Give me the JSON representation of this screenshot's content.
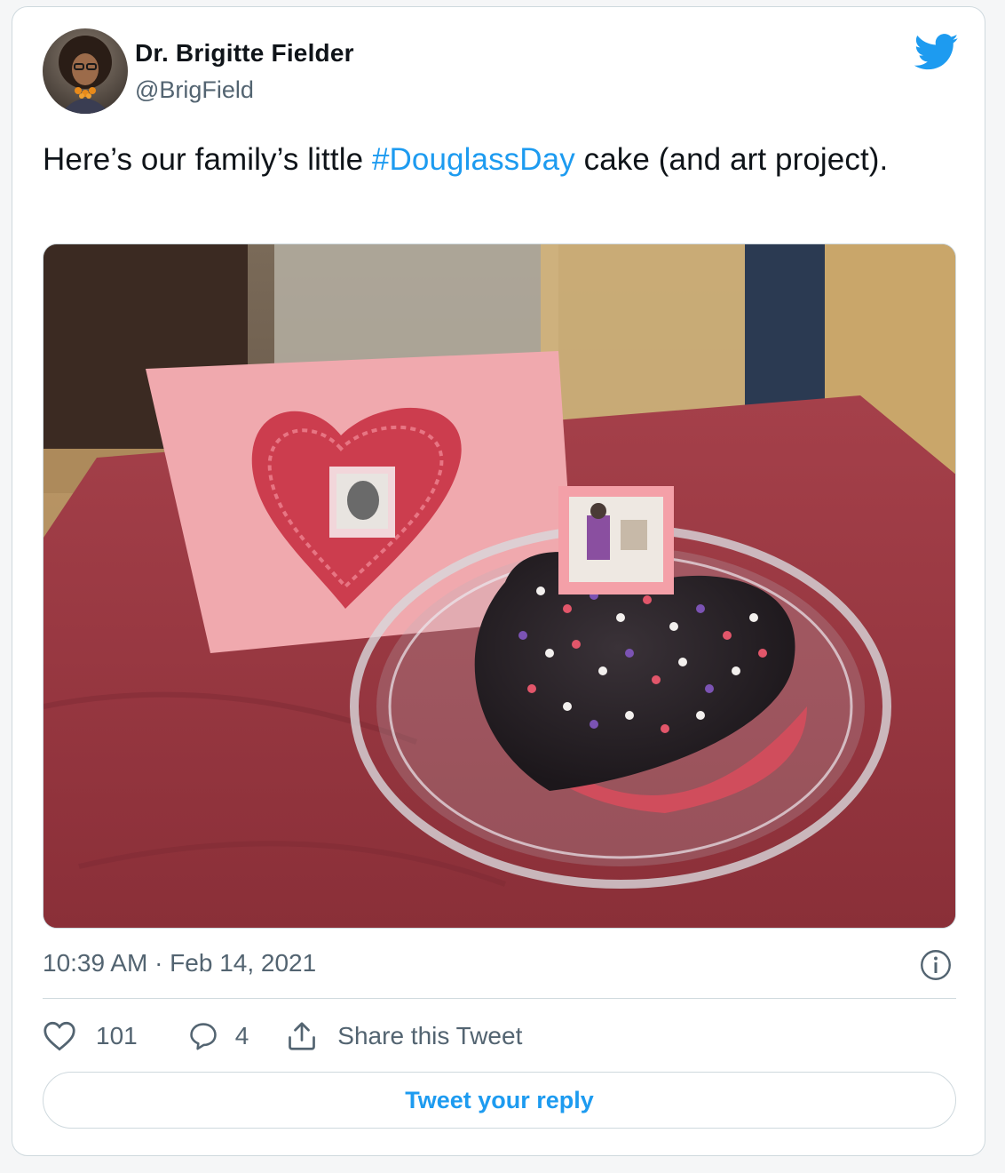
{
  "author": {
    "name": "Dr. Brigitte Fielder",
    "handle": "@BrigField"
  },
  "tweet": {
    "text_before": "Here’s our family’s little ",
    "hashtag": "#DouglassDay",
    "text_after": " cake (and art project)."
  },
  "meta": {
    "timestamp": "10:39 AM · Feb 14, 2021"
  },
  "actions": {
    "likes": "101",
    "replies": "4",
    "share_label": "Share this Tweet"
  },
  "reply_button": {
    "label": "Tweet your reply"
  },
  "icons": {
    "brand": "twitter-bird-icon",
    "info": "info-icon",
    "like": "heart-icon",
    "reply": "reply-bubble-icon",
    "share": "share-icon"
  },
  "colors": {
    "accent": "#1d9bf0",
    "text": "#0f1419",
    "muted": "#536471",
    "border": "#cfd9de"
  }
}
